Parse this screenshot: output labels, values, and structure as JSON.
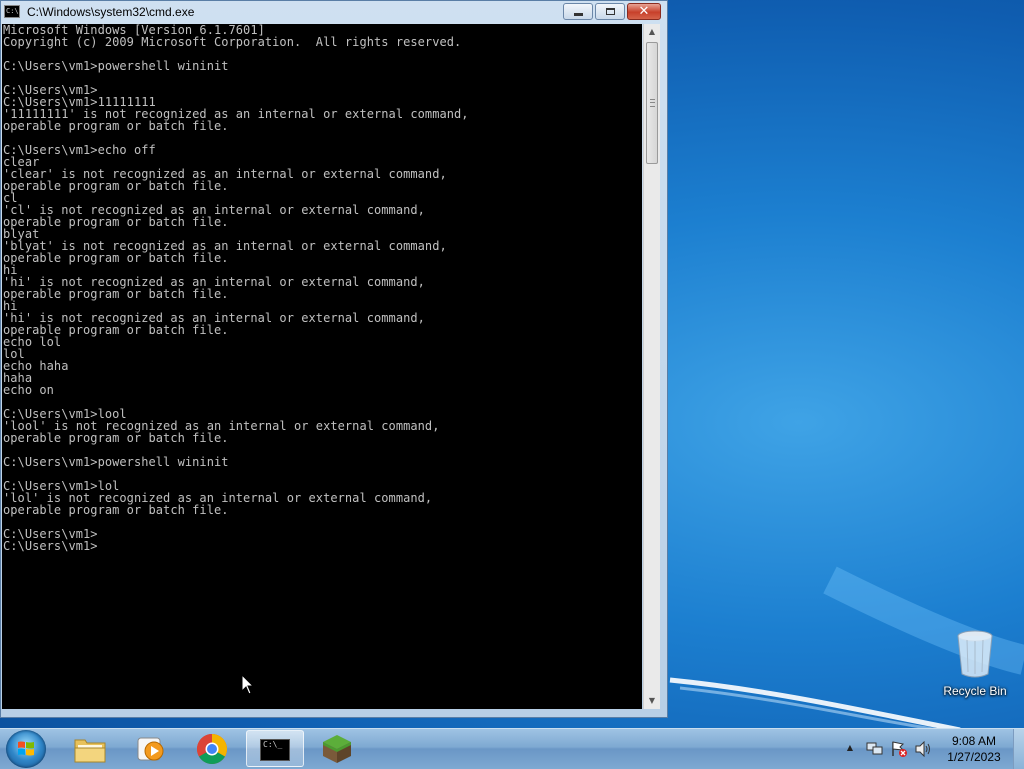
{
  "window": {
    "title": "C:\\Windows\\system32\\cmd.exe",
    "icon": "cmd-icon",
    "controls": {
      "minimize": "minimize-icon",
      "maximize": "maximize-icon",
      "close": "close-icon"
    },
    "console_text": "Microsoft Windows [Version 6.1.7601]\nCopyright (c) 2009 Microsoft Corporation.  All rights reserved.\n\nC:\\Users\\vm1>powershell wininit\n\nC:\\Users\\vm1>\nC:\\Users\\vm1>11111111\n'11111111' is not recognized as an internal or external command,\noperable program or batch file.\n\nC:\\Users\\vm1>echo off\nclear\n'clear' is not recognized as an internal or external command,\noperable program or batch file.\ncl\n'cl' is not recognized as an internal or external command,\noperable program or batch file.\nblyat\n'blyat' is not recognized as an internal or external command,\noperable program or batch file.\nhi\n'hi' is not recognized as an internal or external command,\noperable program or batch file.\nhi\n'hi' is not recognized as an internal or external command,\noperable program or batch file.\necho lol\nlol\necho haha\nhaha\necho on\n\nC:\\Users\\vm1>lool\n'lool' is not recognized as an internal or external command,\noperable program or batch file.\n\nC:\\Users\\vm1>powershell wininit\n\nC:\\Users\\vm1>lol\n'lol' is not recognized as an internal or external command,\noperable program or batch file.\n\nC:\\Users\\vm1>\nC:\\Users\\vm1>"
  },
  "desktop": {
    "icons": [
      {
        "label": "Recycle Bin",
        "icon": "recycle-bin-icon"
      }
    ]
  },
  "taskbar": {
    "start_icon": "windows-start-icon",
    "pinned": [
      {
        "name": "windows-explorer",
        "icon": "folder-icon",
        "active": false
      },
      {
        "name": "media-player",
        "icon": "media-player-icon",
        "active": false
      },
      {
        "name": "chrome",
        "icon": "chrome-icon",
        "active": false
      },
      {
        "name": "command-prompt",
        "icon": "cmd-icon",
        "active": true
      },
      {
        "name": "minecraft",
        "icon": "minecraft-icon",
        "active": false
      }
    ],
    "tray_icons": [
      "show-hidden-icons-arrow",
      "network-icon",
      "action-center-icon",
      "volume-icon"
    ],
    "clock": {
      "time": "9:08 AM",
      "date": "1/27/2023"
    }
  },
  "colors": {
    "console_bg": "#000000",
    "console_fg": "#c0c0c0",
    "desktop_blue": "#1c7fd0",
    "close_button_red": "#c7402b"
  }
}
